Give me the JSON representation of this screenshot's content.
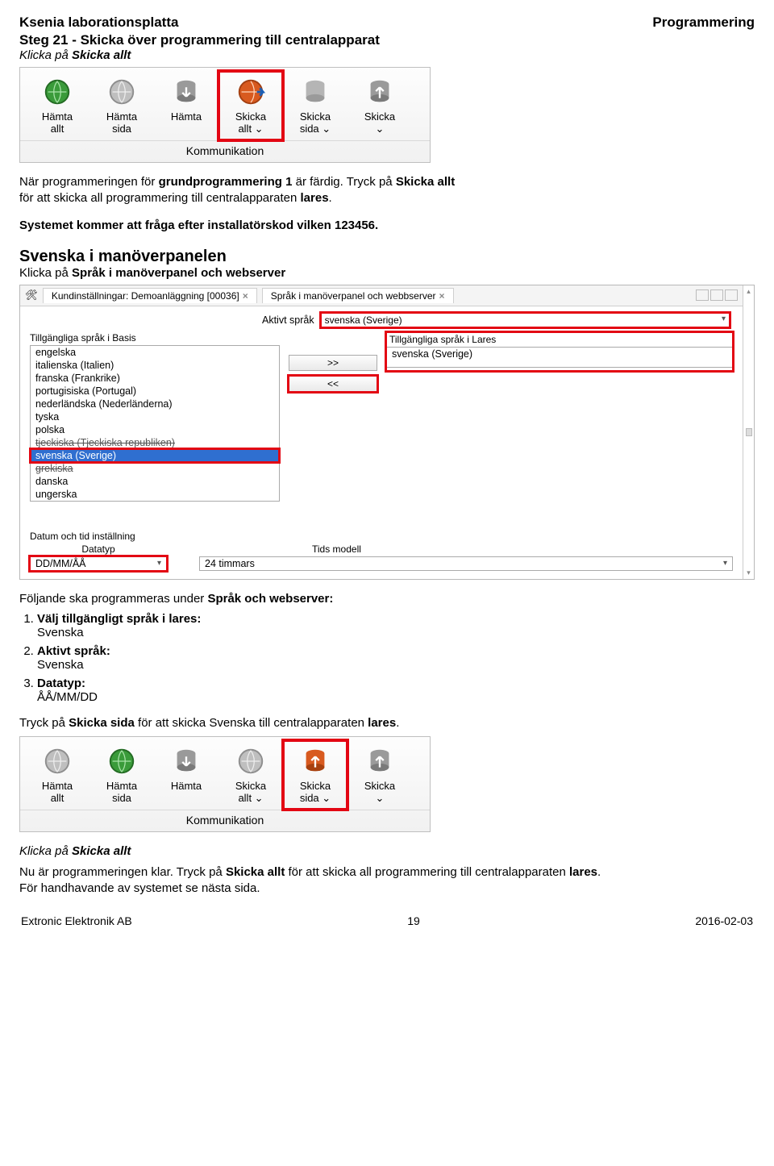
{
  "header": {
    "left": "Ksenia laborationsplatta",
    "right": "Programmering"
  },
  "step": {
    "title": "Steg 21 - Skicka över programmering till centralapparat",
    "click_line_prefix": "Klicka på ",
    "click_target": "Skicka allt"
  },
  "toolbar": {
    "buttons": [
      {
        "l1": "Hämta",
        "l2": "allt",
        "icon": "globe-green"
      },
      {
        "l1": "Hämta",
        "l2": "sida",
        "icon": "globe-gray"
      },
      {
        "l1": "Hämta",
        "l2": "",
        "icon": "db-down"
      },
      {
        "l1": "Skicka",
        "l2": "allt ⌄",
        "icon": "globe-red",
        "hl": true
      },
      {
        "l1": "Skicka",
        "l2": "sida ⌄",
        "icon": "db-gray"
      },
      {
        "l1": "Skicka",
        "l2": "⌄",
        "icon": "db-up"
      }
    ],
    "caption": "Kommunikation"
  },
  "para1": {
    "t1": "När programmeringen för ",
    "b1": "grundprogrammering 1",
    "t2": " är färdig. Tryck på ",
    "b2": "Skicka allt",
    "t3": " för att skicka all programmering till centralapparaten ",
    "b3": "lares",
    "t4": "."
  },
  "para2": "Systemet kommer att fråga efter installatörskod vilken 123456.",
  "swedish": {
    "heading": "Svenska i manöverpanelen",
    "sub_prefix": "Klicka på ",
    "sub_bold": "Språk i manöverpanel och webserver"
  },
  "lang_panel": {
    "tab1": "Kundinställningar: Demoanläggning [00036]",
    "tab2": "Språk i manöverpanel och webbserver",
    "active_label": "Aktivt språk",
    "active_value": "svenska (Sverige)",
    "left_title": "Tillgängliga språk i Basis",
    "left_items": [
      "engelska",
      "italienska (Italien)",
      "franska (Frankrike)",
      "portugisiska (Portugal)",
      "nederländska (Nederländerna)",
      "tyska",
      "polska",
      "tjeckiska (Tjeckiska republiken)",
      "svenska (Sverige)",
      "grekiska",
      "danska",
      "ungerska"
    ],
    "left_strike_idx": 7,
    "left_selected_idx": 8,
    "left_strike2_idx": 9,
    "right_title": "Tillgängliga språk i Lares",
    "right_items": [
      "svenska (Sverige)"
    ],
    "btn_right": ">>",
    "btn_left": "<<",
    "date_section": "Datum och tid inställning",
    "datatyp_label": "Datatyp",
    "datatyp_value": "DD/MM/ÅÅ",
    "tids_label": "Tids modell",
    "tids_value": "24 timmars"
  },
  "follow": {
    "intro_prefix": "Följande ska programmeras under ",
    "intro_bold": "Språk och webserver:",
    "items": [
      {
        "head": "Välj tillgängligt språk i lares:",
        "val": "Svenska"
      },
      {
        "head": "Aktivt språk:",
        "val": "Svenska"
      },
      {
        "head": "Datatyp:",
        "val": "ÅÅ/MM/DD"
      }
    ]
  },
  "para3": {
    "t1": "Tryck på ",
    "b1": "Skicka sida",
    "t2": " för att skicka Svenska till centralapparaten ",
    "b2": "lares",
    "t3": "."
  },
  "toolbar2": {
    "buttons": [
      {
        "l1": "Hämta",
        "l2": "allt",
        "icon": "globe-gray"
      },
      {
        "l1": "Hämta",
        "l2": "sida",
        "icon": "globe-green"
      },
      {
        "l1": "Hämta",
        "l2": "",
        "icon": "db-down"
      },
      {
        "l1": "Skicka",
        "l2": "allt ⌄",
        "icon": "globe-gray"
      },
      {
        "l1": "Skicka",
        "l2": "sida ⌄",
        "icon": "db-red",
        "hl": true
      },
      {
        "l1": "Skicka",
        "l2": "⌄",
        "icon": "db-up"
      }
    ],
    "caption": "Kommunikation"
  },
  "closing": {
    "click_prefix": "Klicka på ",
    "click_bold": "Skicka allt",
    "line2_a": "Nu är programmeringen klar. Tryck på ",
    "line2_b": "Skicka allt",
    "line2_c": " för att skicka all programmering till centralapparaten ",
    "line2_d": "lares",
    "line2_e": ".",
    "line3": "För handhavande av systemet se nästa sida."
  },
  "footer": {
    "left": "Extronic Elektronik AB",
    "center": "19",
    "right": "2016-02-03"
  }
}
